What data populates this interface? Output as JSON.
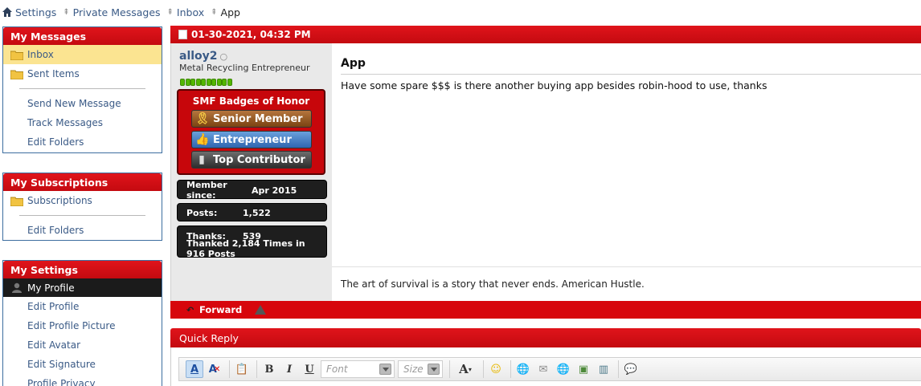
{
  "breadcrumb": {
    "items": [
      "Settings",
      "Private Messages",
      "Inbox"
    ],
    "current": "App"
  },
  "sidebar": {
    "my_messages": {
      "title": "My Messages",
      "inbox": "Inbox",
      "sent": "Sent Items",
      "send_new": "Send New Message",
      "track": "Track Messages",
      "edit_folders": "Edit Folders"
    },
    "my_subscriptions": {
      "title": "My Subscriptions",
      "subscriptions": "Subscriptions",
      "edit_folders": "Edit Folders"
    },
    "my_settings": {
      "title": "My Settings",
      "my_profile": "My Profile",
      "edit_profile": "Edit Profile",
      "edit_profile_picture": "Edit Profile Picture",
      "edit_avatar": "Edit Avatar",
      "edit_signature": "Edit Signature",
      "profile_privacy": "Profile Privacy"
    }
  },
  "message": {
    "date": "01-30-2021, 04:32 PM",
    "title": "App",
    "body": "Have some spare $$$ is there another buying app besides robin-hood to use, thanks",
    "signature": "The art of survival is a story that never ends. American Hustle.",
    "forward_label": "Forward"
  },
  "user": {
    "name": "alloy2",
    "online_status": "○",
    "title": "Metal Recycling Entrepreneur",
    "badges_title": "SMF Badges of Honor",
    "badges": [
      "Senior Member",
      "Entrepreneur",
      "Top Contributor"
    ],
    "member_since_label": "Member since:",
    "member_since": "Apr 2015",
    "posts_label": "Posts:",
    "posts": "1,522",
    "thanks_label": "Thanks:",
    "thanks": "539",
    "thanked_line": "Thanked 2,184 Times in 916 Posts"
  },
  "quick_reply": {
    "title": "Quick Reply",
    "font_placeholder": "Font",
    "size_placeholder": "Size"
  },
  "colors": {
    "header_red": "#d7060c",
    "link_blue": "#3a5a86",
    "active_yellow": "#fbe491"
  }
}
